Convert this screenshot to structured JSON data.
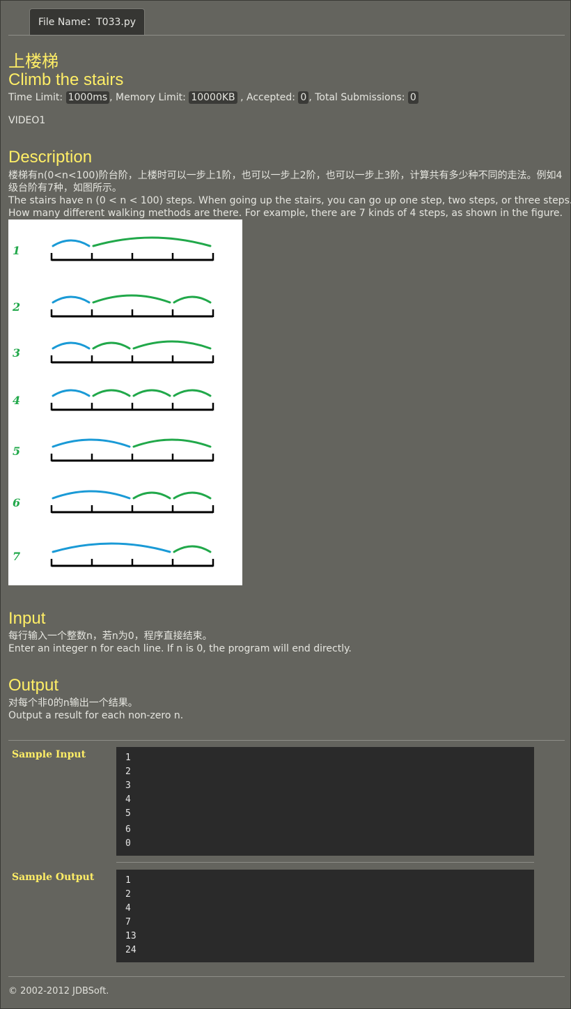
{
  "tab": {
    "file_name": "File Name：T033.py"
  },
  "title": {
    "cn": "上楼梯",
    "en": "Climb the stairs"
  },
  "limits": {
    "time_label": "Time Limit: ",
    "time_value": "1000ms",
    "memory_label": ", Memory Limit: ",
    "memory_value": "10000KB",
    "accepted_label": " , Accepted: ",
    "accepted_value": "0",
    "total_label": ", Total Submissions: ",
    "total_value": "0"
  },
  "video": "VIDEO1",
  "description": {
    "heading": "Description",
    "cn_line1": "楼梯有n(0<n<100)阶台阶，上楼时可以一步上1阶，也可以一步上2阶，也可以一步上3阶，计算共有多少种不同的走法。例如4",
    "cn_line2": "级台阶有7种，如图所示。",
    "en_line1": "The stairs have n (0 < n < 100) steps. When going up the stairs, you can go up one step, two steps, or three steps.",
    "en_line2": "How many different walking methods are there. For example, there are 7 kinds of 4 steps, as shown in the figure."
  },
  "figure": {
    "row_labels": [
      "1",
      "2",
      "3",
      "4",
      "5",
      "6",
      "7"
    ],
    "colors": {
      "blue": "#1a9ad6",
      "green": "#21a84a",
      "label": "#21a84a"
    }
  },
  "input": {
    "heading": "Input",
    "cn": "每行输入一个整数n，若n为0，程序直接结束。",
    "en": "Enter an integer n for each line. If n is 0, the program will end directly."
  },
  "output": {
    "heading": "Output",
    "cn": "对每个非0的n输出一个结果。",
    "en": "Output a result for each non-zero n."
  },
  "sample_input": {
    "label": "Sample Input",
    "lines": [
      "1",
      "2",
      "3",
      "4",
      "5",
      "6",
      "0"
    ]
  },
  "sample_output": {
    "label": "Sample Output",
    "lines": [
      "1",
      "2",
      "4",
      "7",
      "13",
      "24"
    ]
  },
  "footer": "© 2002-2012  JDBSoft."
}
